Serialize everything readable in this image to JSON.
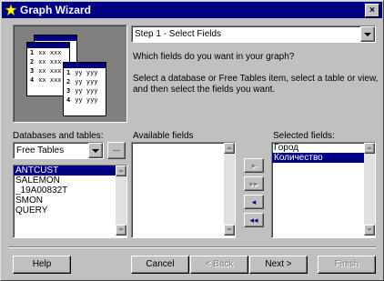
{
  "window": {
    "title": "Graph Wizard",
    "close_label": "×"
  },
  "step_select": {
    "value": "Step 1 - Select Fields"
  },
  "instructions": {
    "question": "Which fields do you want in your graph?",
    "detail": "Select a database or Free Tables item, select a table or view, and then select the fields you want."
  },
  "illustration": {
    "rows": [
      {
        "num": "1",
        "text": "xx xxx"
      },
      {
        "num": "2",
        "text": "xx xxx"
      },
      {
        "num": "3",
        "text": "xx xxx"
      },
      {
        "num": "4",
        "text": "xx xxx"
      }
    ],
    "front_rows": [
      {
        "num": "1",
        "text": "yy yyy"
      },
      {
        "num": "2",
        "text": "yy yyy"
      },
      {
        "num": "3",
        "text": "yy yyy"
      },
      {
        "num": "4",
        "text": "yy yyy"
      }
    ]
  },
  "databases": {
    "label": "Databases and tables:",
    "combo_value": "Free Tables",
    "browse_label": "...",
    "tables": [
      "ANTCUST",
      "SALEMON",
      "_19A00832T",
      "SMON",
      "QUERY"
    ],
    "selected_index": 0
  },
  "available": {
    "label": "Available fields",
    "items": []
  },
  "selected": {
    "label": "Selected fields:",
    "items": [
      "Город",
      "Количество"
    ],
    "selected_index": 1
  },
  "move_buttons": {
    "add": "▸",
    "add_all": "▸▸",
    "remove": "◂",
    "remove_all": "◂◂"
  },
  "buttons": {
    "help": "Help",
    "cancel": "Cancel",
    "back": "< Back",
    "next": "Next >",
    "finish": "Finish"
  },
  "colors": {
    "titlebar": "#000080",
    "selection": "#000080",
    "face": "#c0c0c0"
  }
}
